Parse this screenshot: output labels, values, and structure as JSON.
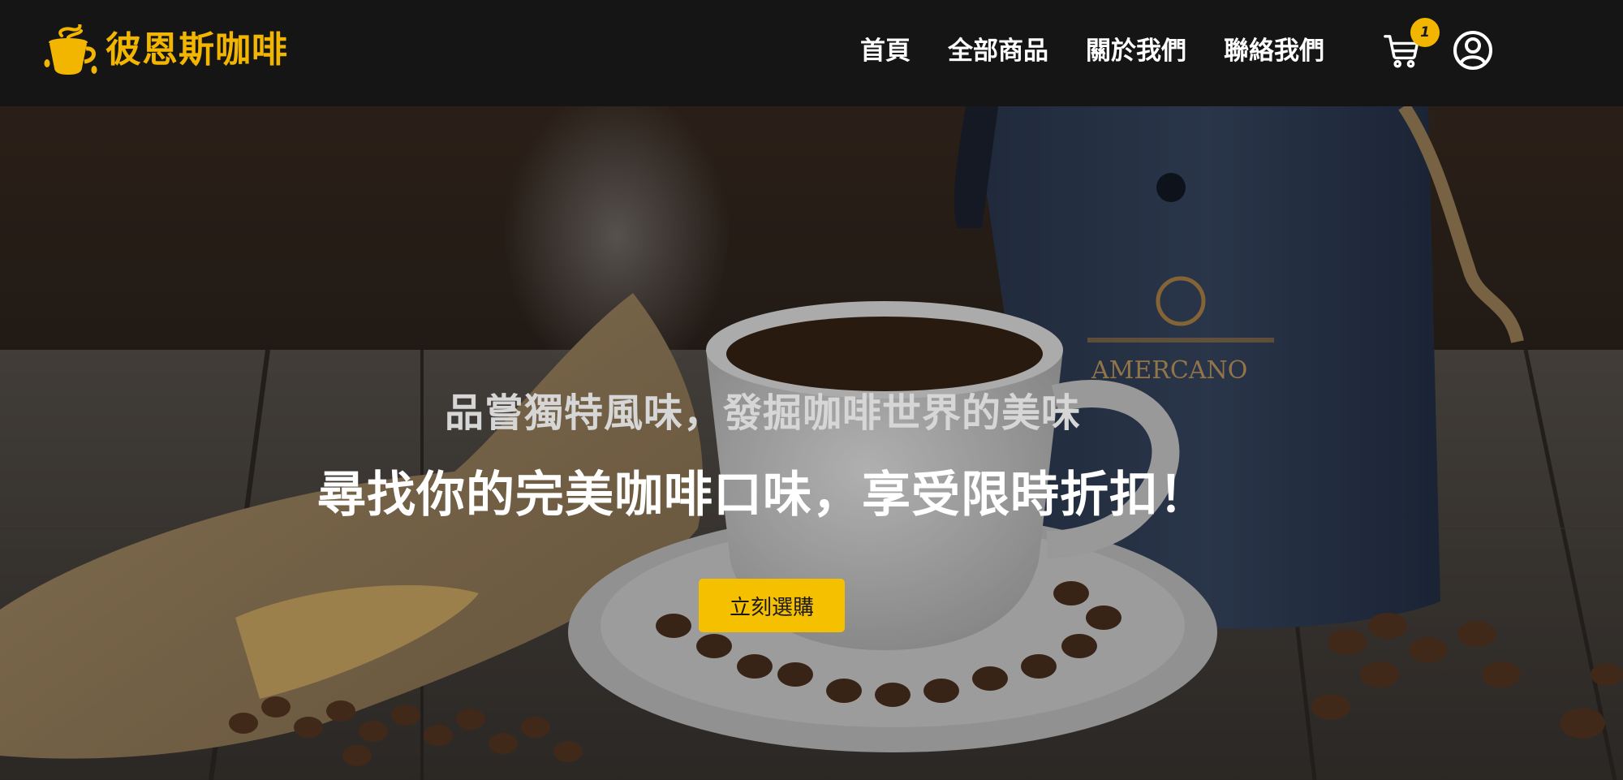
{
  "brand": {
    "name": "彼恩斯咖啡",
    "logo_icon": "coffee-cup-logo-icon",
    "color": "#f3b600"
  },
  "nav": {
    "links": [
      {
        "label": "首頁"
      },
      {
        "label": "全部商品"
      },
      {
        "label": "關於我們"
      },
      {
        "label": "聯絡我們"
      }
    ],
    "cart": {
      "icon": "cart-icon",
      "count": "1"
    },
    "account": {
      "icon": "user-circle-icon"
    }
  },
  "hero": {
    "subtitle": "品嘗獨特風味，發掘咖啡世界的美味",
    "title": "尋找你的完美咖啡口味，享受限時折扣！",
    "cta_label": "立刻選購",
    "cta_color": "#f5c000",
    "background_image": "coffee cup on saucer with coffee beans, burlap sack and coffee bag on wooden table"
  }
}
